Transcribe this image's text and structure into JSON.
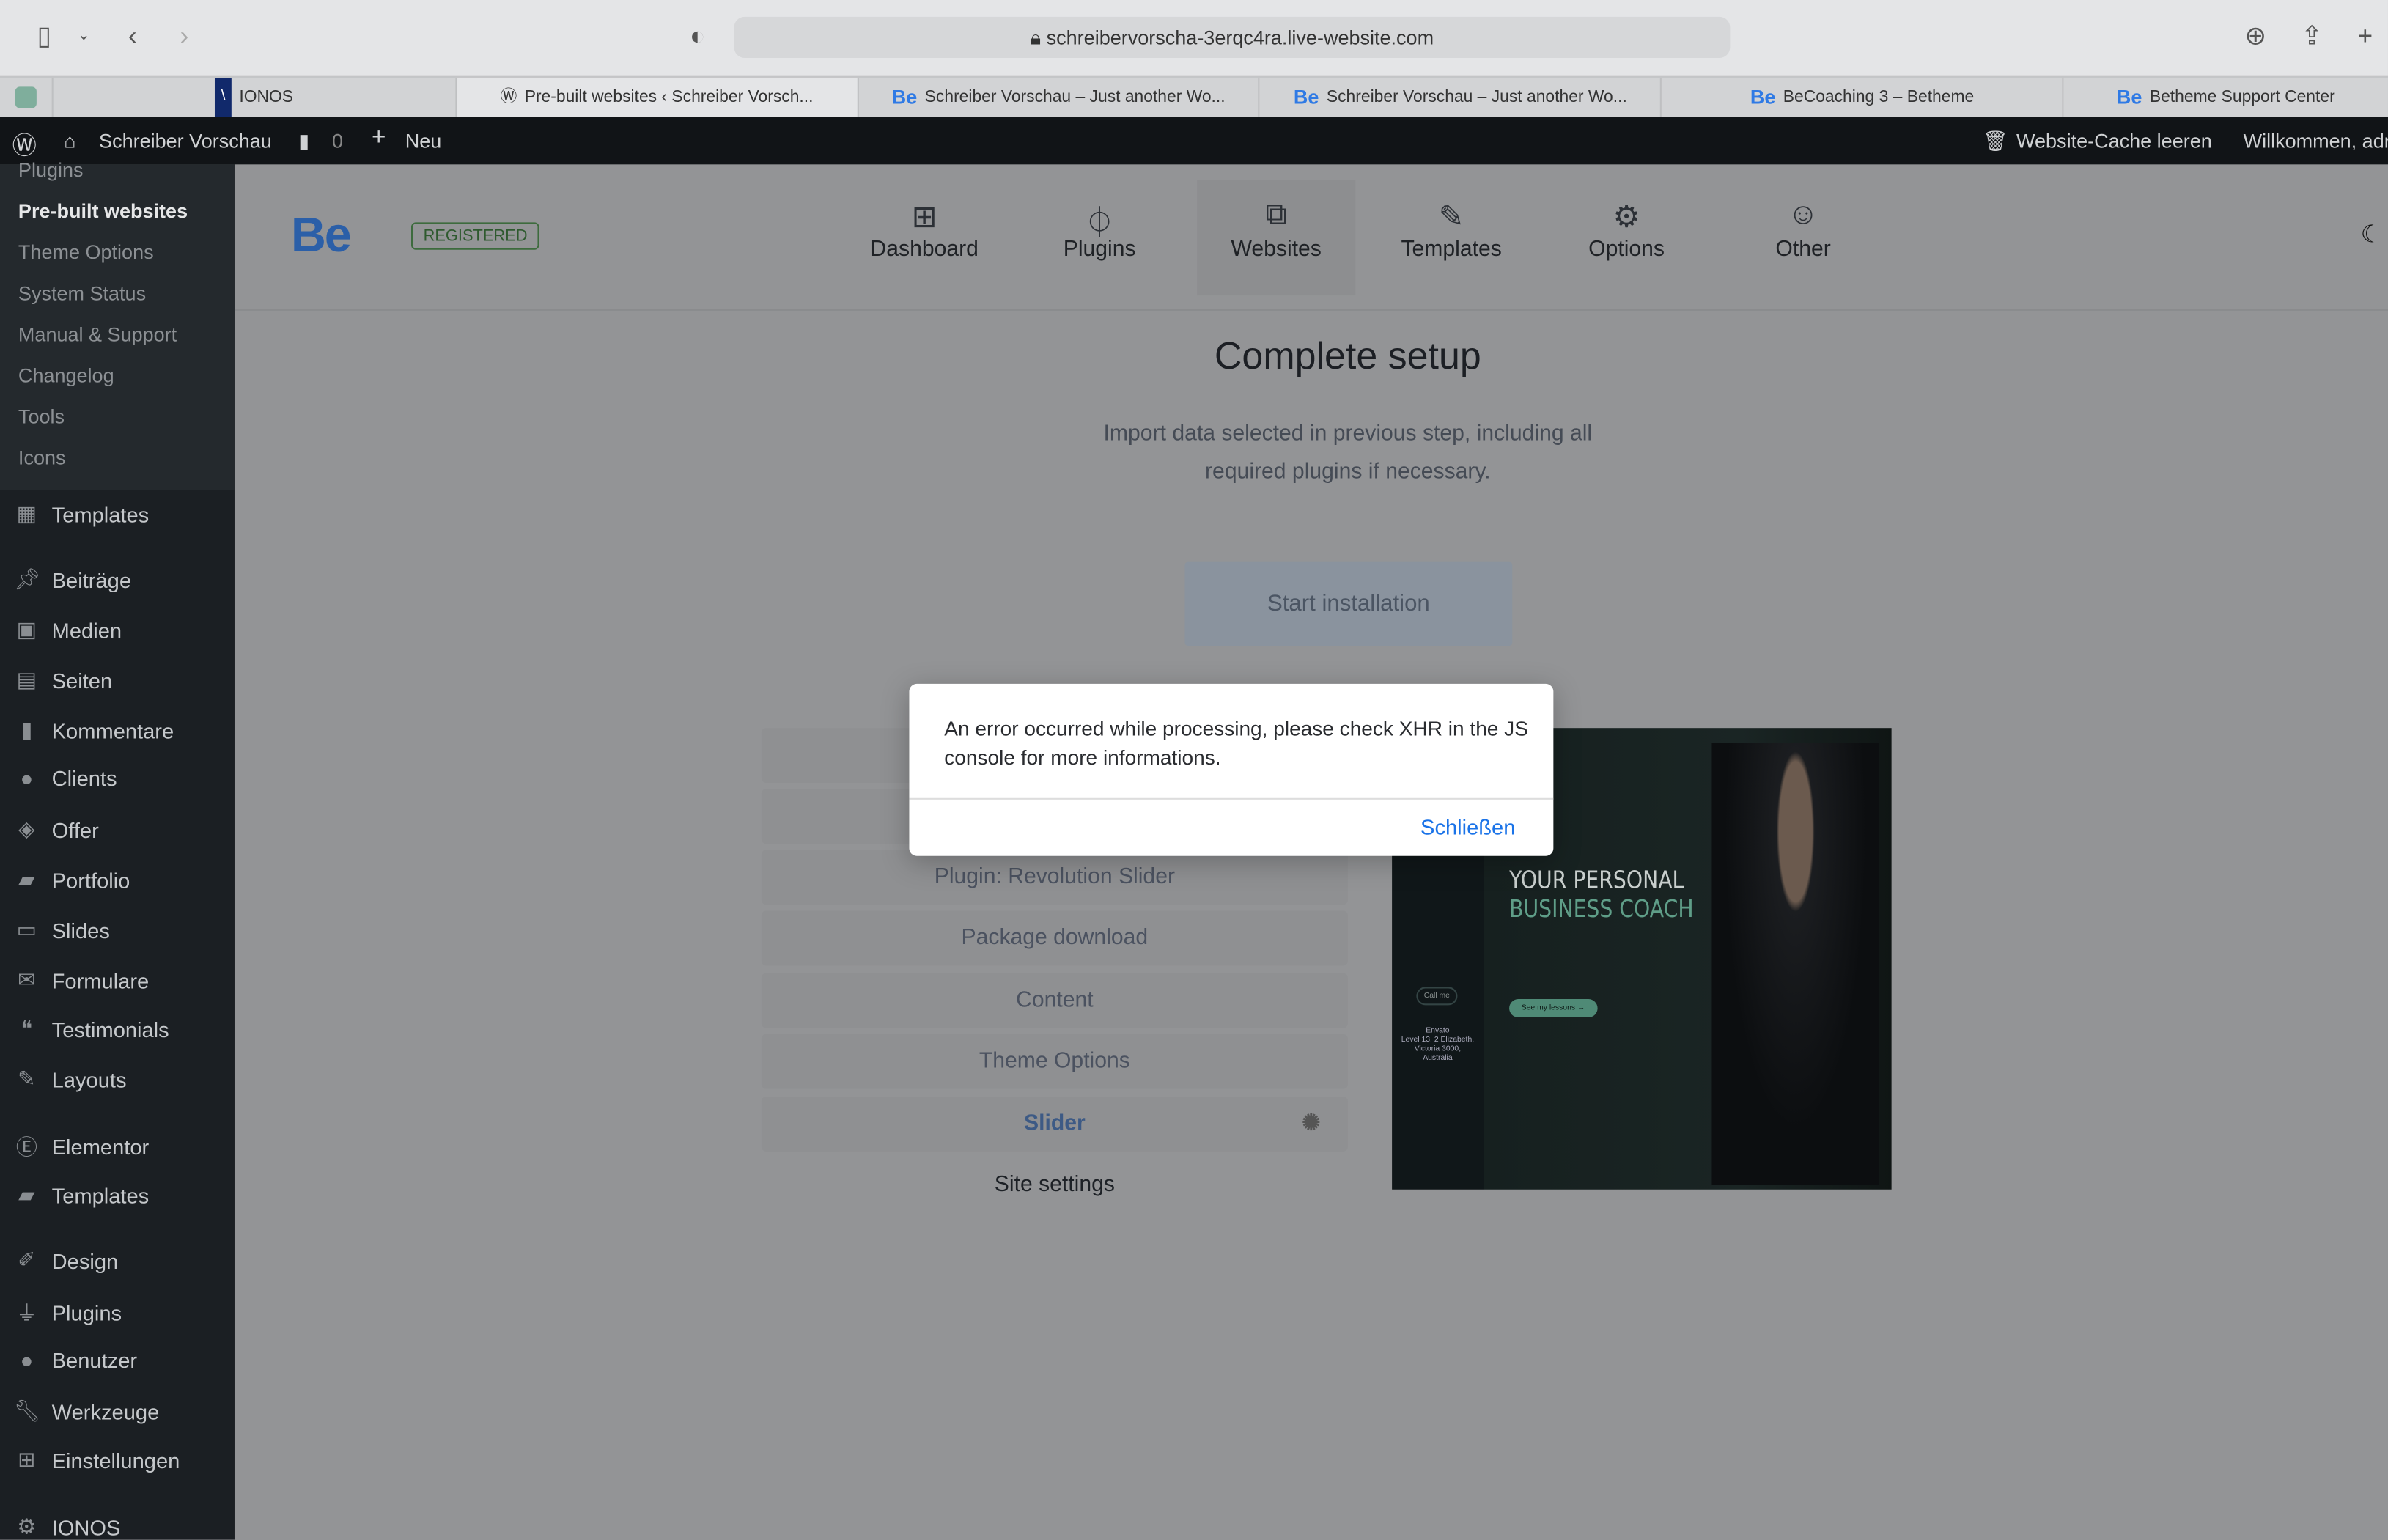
{
  "browser": {
    "url": "schreibervorscha-3erqc4ra.live-website.com",
    "tabs": [
      {
        "label": ""
      },
      {
        "label": "IONOS"
      },
      {
        "label": "Pre-built websites ‹ Schreiber Vorsch..."
      },
      {
        "label": "Schreiber Vorschau – Just another Wo..."
      },
      {
        "label": "Schreiber Vorschau – Just another Wo..."
      },
      {
        "label": "BeCoaching 3 – Betheme"
      },
      {
        "label": "Betheme Support Center"
      }
    ]
  },
  "adminbar": {
    "site": "Schreiber Vorschau",
    "comments": "0",
    "new": "Neu",
    "cache": "Website-Cache leeren",
    "welcome": "Willkommen, adr"
  },
  "sidebar": {
    "submenu": [
      "Plugins",
      "Pre-built websites",
      "Theme Options",
      "System Status",
      "Manual & Support",
      "Changelog",
      "Tools",
      "Icons"
    ],
    "menu": [
      {
        "label": "Templates",
        "icon": "grid"
      },
      {
        "label": "Beiträge",
        "icon": "pin"
      },
      {
        "label": "Medien",
        "icon": "media"
      },
      {
        "label": "Seiten",
        "icon": "page"
      },
      {
        "label": "Kommentare",
        "icon": "comment"
      },
      {
        "label": "Clients",
        "icon": "user"
      },
      {
        "label": "Offer",
        "icon": "tag"
      },
      {
        "label": "Portfolio",
        "icon": "folder"
      },
      {
        "label": "Slides",
        "icon": "slides"
      },
      {
        "label": "Formulare",
        "icon": "mail"
      },
      {
        "label": "Testimonials",
        "icon": "quote"
      },
      {
        "label": "Layouts",
        "icon": "pencil"
      },
      {
        "label": "Elementor",
        "icon": "elementor"
      },
      {
        "label": "Templates",
        "icon": "folder"
      },
      {
        "label": "Design",
        "icon": "brush"
      },
      {
        "label": "Plugins",
        "icon": "plug"
      },
      {
        "label": "Benutzer",
        "icon": "user"
      },
      {
        "label": "Werkzeuge",
        "icon": "wrench"
      },
      {
        "label": "Einstellungen",
        "icon": "settings"
      },
      {
        "label": "IONOS",
        "icon": "gear"
      }
    ]
  },
  "header": {
    "logo": "Be",
    "badge": "REGISTERED",
    "nav": [
      {
        "label": "Dashboard"
      },
      {
        "label": "Plugins"
      },
      {
        "label": "Websites"
      },
      {
        "label": "Templates"
      },
      {
        "label": "Options"
      },
      {
        "label": "Other"
      }
    ],
    "active": "Websites"
  },
  "setup": {
    "title": "Complete setup",
    "subtitle_1": "Import data selected in previous step, including all",
    "subtitle_2": "required plugins if necessary.",
    "button": "Start installation",
    "steps": [
      {
        "label": ""
      },
      {
        "label": ""
      },
      {
        "label": "Plugin: Revolution Slider"
      },
      {
        "label": "Package download"
      },
      {
        "label": "Content"
      },
      {
        "label": "Theme Options"
      },
      {
        "label": "Slider",
        "status": "loading"
      },
      {
        "label": "Site settings"
      }
    ]
  },
  "preview": {
    "headline_1": "YOUR PERSONAL",
    "headline_2": "BUSINESS COACH",
    "cta": "See my lessons →",
    "call": "Call me",
    "address": "Envato\nLevel 13, 2 Elizabeth,\nVictoria 3000,\nAustralia"
  },
  "modal": {
    "message": "An error occurred while processing, please check XHR in the JS console for more informations.",
    "close": "Schließen",
    "accent": "#1a73e8"
  }
}
